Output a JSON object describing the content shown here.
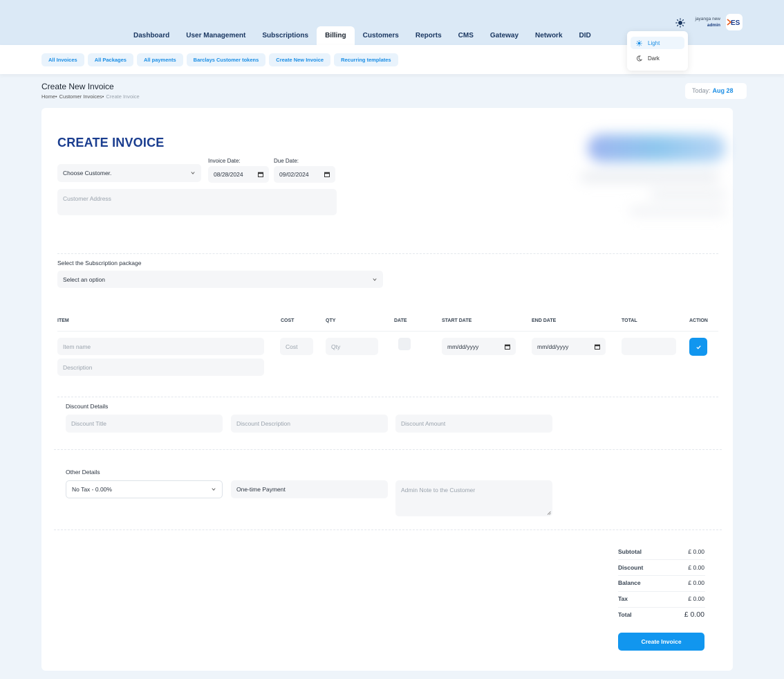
{
  "header": {
    "nav": [
      "Dashboard",
      "User Management",
      "Subscriptions",
      "Billing",
      "Customers",
      "Reports",
      "CMS",
      "Gateway",
      "Network",
      "DID"
    ],
    "active_nav": "Billing",
    "user": {
      "name": "jayanga new",
      "role": "admin"
    },
    "logo_text": "ES"
  },
  "subnav": [
    "All Invoices",
    "All Packages",
    "All payments",
    "Barclays Customer tokens",
    "Create New Invoice",
    "Recurring templates"
  ],
  "theme_menu": {
    "light": "Light",
    "dark": "Dark",
    "selected": "Light"
  },
  "page": {
    "title": "Create New Invoice",
    "breadcrumb": [
      "Home•",
      "Customer Invoices•",
      "Create Invoice"
    ],
    "today_label": "Today:",
    "today_value": "Aug 28"
  },
  "form": {
    "heading": "CREATE INVOICE",
    "customer_select": "Choose Customer.",
    "invoice_date_label": "Invoice Date:",
    "invoice_date": "08/28/2024",
    "due_date_label": "Due Date:",
    "due_date": "09/02/2024",
    "address_placeholder": "Customer Address",
    "package_label": "Select the Subscription package",
    "package_select": "Select an option"
  },
  "items_table": {
    "headers": [
      "ITEM",
      "COST",
      "QTY",
      "DATE",
      "START DATE",
      "END DATE",
      "TOTAL",
      "ACTION"
    ],
    "item_placeholder": "Item name",
    "description_placeholder": "Description",
    "cost_placeholder": "Cost",
    "qty_placeholder": "Qty",
    "start_date_placeholder": "mm/dd/yyyy",
    "end_date_placeholder": "mm/dd/yyyy"
  },
  "discount": {
    "label": "Discount Details",
    "title_placeholder": "Discount Title",
    "description_placeholder": "Discount Description",
    "amount_placeholder": "Discount Amount"
  },
  "other": {
    "label": "Other Details",
    "tax_select": "No Tax - 0.00%",
    "payment_type": "One-time Payment",
    "note_placeholder": "Admin Note to the Customer"
  },
  "summary": [
    {
      "label": "Subtotal",
      "value": "£ 0.00"
    },
    {
      "label": "Discount",
      "value": "£ 0.00"
    },
    {
      "label": "Balance",
      "value": "£ 0.00"
    },
    {
      "label": "Tax",
      "value": "£ 0.00"
    },
    {
      "label": "Total",
      "value": "£ 0.00"
    }
  ],
  "create_button": "Create Invoice",
  "colors": {
    "accent": "#1196ef",
    "heading": "#1a3d8f",
    "header_bg": "#dbe9f6"
  }
}
